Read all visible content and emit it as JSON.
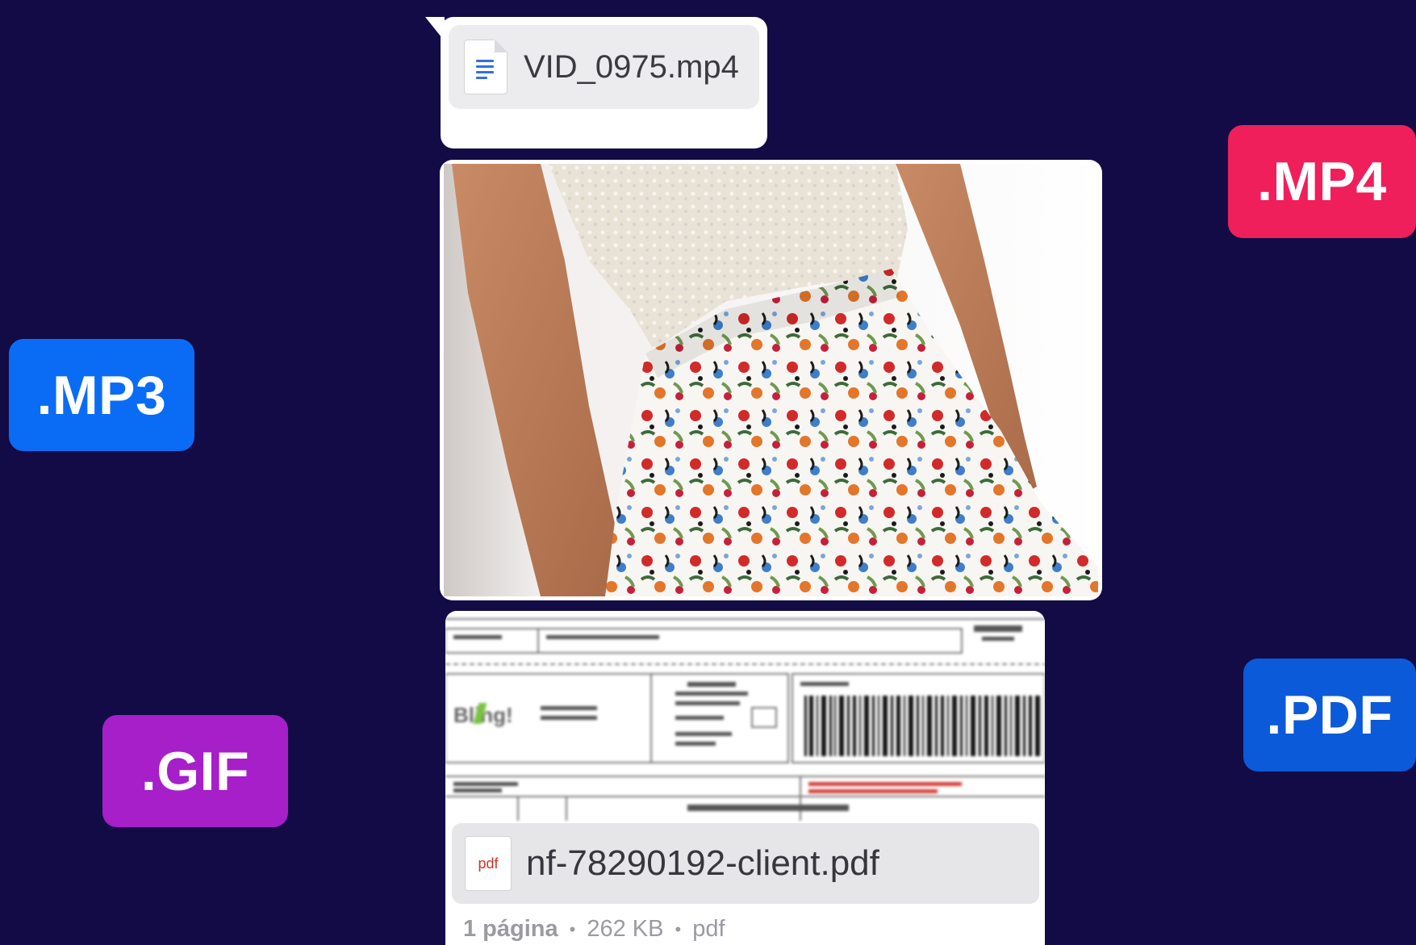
{
  "badges": {
    "mp3": {
      "label": ".MP3",
      "color": "#0a6cf5"
    },
    "gif": {
      "label": ".GIF",
      "color": "#a61fc9"
    },
    "mp4": {
      "label": ".MP4",
      "color": "#ef1f5b"
    },
    "pdf": {
      "label": ".PDF",
      "color": "#0b5ad9"
    }
  },
  "video_message": {
    "file_name": "VID_0975.mp4",
    "icon": "google-doc-icon"
  },
  "photo_message": {
    "icon": "photo-image"
  },
  "pdf_message": {
    "file_name": "nf-78290192-client.pdf",
    "icon_label": "pdf",
    "meta": {
      "pages": "1 página",
      "size": "262 KB",
      "type": "pdf"
    },
    "preview_brand": "Bling!"
  }
}
